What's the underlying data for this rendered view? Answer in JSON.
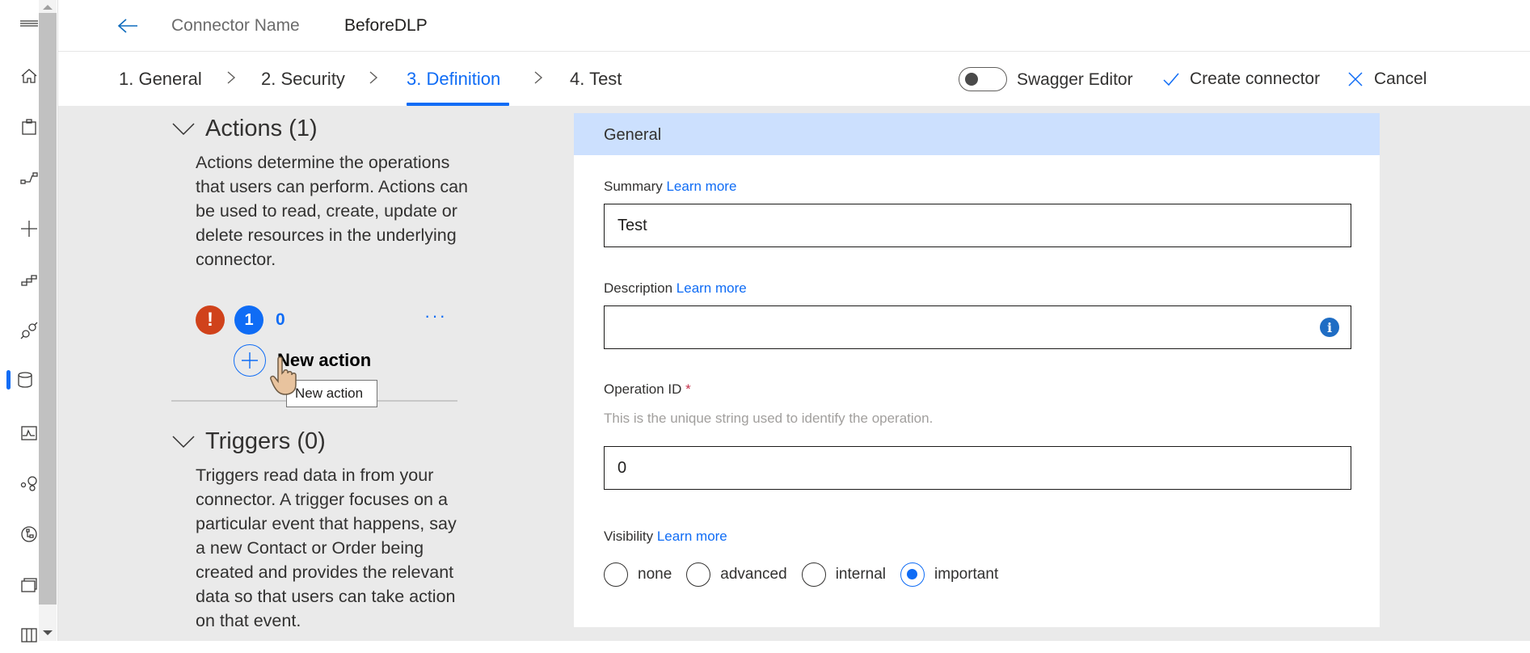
{
  "header": {
    "back_label": "Back",
    "connector_name_label": "Connector Name",
    "connector_name_value": "BeforeDLP"
  },
  "wizard": {
    "tabs": [
      {
        "label": "1. General",
        "active": false
      },
      {
        "label": "2. Security",
        "active": false
      },
      {
        "label": "3. Definition",
        "active": true
      },
      {
        "label": "4. Test",
        "active": false
      }
    ]
  },
  "toolbar": {
    "swagger_editor_label": "Swagger Editor",
    "swagger_editor_on": false,
    "create_label": "Create connector",
    "cancel_label": "Cancel"
  },
  "rail": {
    "items": [
      {
        "icon": "menu-icon"
      },
      {
        "icon": "home-icon"
      },
      {
        "icon": "clipboard-icon"
      },
      {
        "icon": "flow-icon"
      },
      {
        "icon": "plus-icon"
      },
      {
        "icon": "templates-icon"
      },
      {
        "icon": "connector-plug-icon"
      },
      {
        "icon": "data-cylinder-icon",
        "active": true
      },
      {
        "icon": "monitor-icon"
      },
      {
        "icon": "ai-builder-icon"
      },
      {
        "icon": "process-advisor-icon"
      },
      {
        "icon": "solutions-icon"
      },
      {
        "icon": "learn-book-icon"
      }
    ]
  },
  "actions": {
    "title": "Actions (1)",
    "description": "Actions determine the operations that users can perform. Actions can be used to read, create, update or delete resources in the underlying connector.",
    "error_badge": "!",
    "info_badge": "1",
    "count": "0",
    "more_label": "···",
    "new_action_label": "New action",
    "tooltip": "New action"
  },
  "triggers": {
    "title": "Triggers (0)",
    "description": "Triggers read data in from your connector. A trigger focuses on a particular event that happens, say a new Contact or Order being created and provides the relevant data so that users can take action on that event."
  },
  "general": {
    "title": "General",
    "summary": {
      "label": "Summary",
      "link": "Learn more",
      "value": "Test"
    },
    "description": {
      "label": "Description",
      "link": "Learn more",
      "value": ""
    },
    "operation_id": {
      "label": "Operation ID",
      "required_mark": "*",
      "hint": "This is the unique string used to identify the operation.",
      "value": "0"
    },
    "visibility": {
      "label": "Visibility",
      "link": "Learn more",
      "options": [
        "none",
        "advanced",
        "internal",
        "important"
      ],
      "selected": "important"
    }
  },
  "colors": {
    "accent": "#0f6cf5",
    "error": "#d0421b",
    "card_header": "#cce0fe",
    "content_bg": "#eaeaea"
  }
}
